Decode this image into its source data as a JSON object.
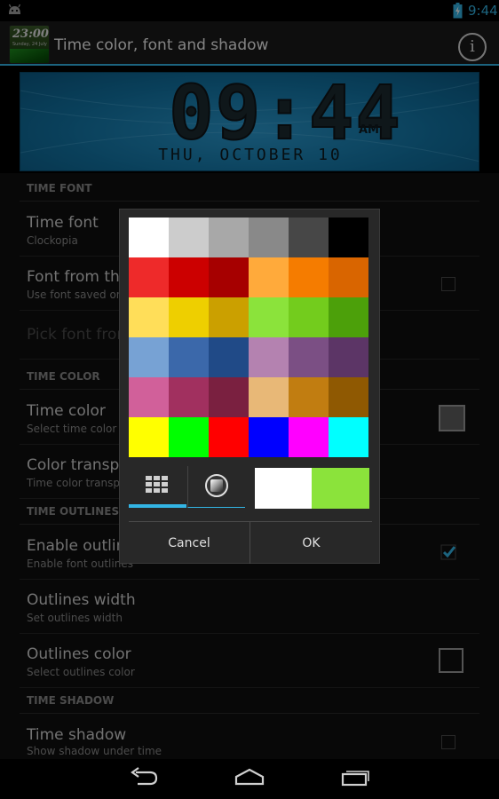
{
  "status_bar": {
    "time": "9:44",
    "icons": [
      "android-icon",
      "battery-charging-icon"
    ]
  },
  "action_bar": {
    "title": "Time color, font and shadow",
    "app_icon": {
      "time": "23:00",
      "date": "Sunday, 24 July"
    },
    "info_icon": "info-icon",
    "info_glyph": "i"
  },
  "preview": {
    "time": "09:44",
    "ampm": "AM",
    "date": "THU, OCTOBER 10"
  },
  "settings": {
    "time_font_header": "TIME FONT",
    "time_font": {
      "title": "Time font",
      "summary": "Clockopia"
    },
    "font_from_file": {
      "title": "Font from the",
      "summary": "Use font saved on",
      "checked": false
    },
    "pick_font": {
      "title": "Pick font from"
    },
    "time_color_header": "TIME COLOR",
    "time_color": {
      "title": "Time color",
      "summary": "Select time color",
      "swatch": "#606060"
    },
    "color_transparency": {
      "title": "Color transpa",
      "summary": "Time color transp"
    },
    "time_outlines_header": "TIME OUTLINES",
    "enable_outlines": {
      "title": "Enable outline",
      "summary": "Enable font outlines",
      "checked": true
    },
    "outlines_width": {
      "title": "Outlines width",
      "summary": "Set outlines width"
    },
    "outlines_color": {
      "title": "Outlines color",
      "summary": "Select outlines color"
    },
    "time_shadow_header": "TIME SHADOW",
    "time_shadow": {
      "title": "Time shadow",
      "summary": "Show shadow under time",
      "checked": false
    }
  },
  "color_dialog": {
    "palette": [
      [
        "#ffffff",
        "#cccccc",
        "#a8a8a8",
        "#898989",
        "#474747",
        "#000000"
      ],
      [
        "#ee2a2a",
        "#cc0000",
        "#a60000",
        "#ffaa3b",
        "#f57c00",
        "#d96500"
      ],
      [
        "#ffde59",
        "#eecf00",
        "#cba000",
        "#8be33b",
        "#73cc1d",
        "#4ca00a"
      ],
      [
        "#77a2d4",
        "#3b68aa",
        "#204a87",
        "#b482b0",
        "#7b4f84",
        "#5c3566"
      ],
      [
        "#d1609a",
        "#a1305f",
        "#7a2040",
        "#e8b877",
        "#c17d11",
        "#8f5902"
      ],
      [
        "#ffff00",
        "#00ff00",
        "#ff0000",
        "#0000ff",
        "#ff00ff",
        "#00ffff"
      ]
    ],
    "tabs": [
      {
        "icon": "palette-grid-icon",
        "selected": true
      },
      {
        "icon": "gradient-picker-icon",
        "selected": false
      }
    ],
    "old_color": "#ffffff",
    "new_color": "#8be33b",
    "cancel_label": "Cancel",
    "ok_label": "OK"
  },
  "accent_color": "#33b5e5",
  "nav_bar": {
    "icons": [
      "back-icon",
      "home-icon",
      "recent-apps-icon"
    ]
  }
}
